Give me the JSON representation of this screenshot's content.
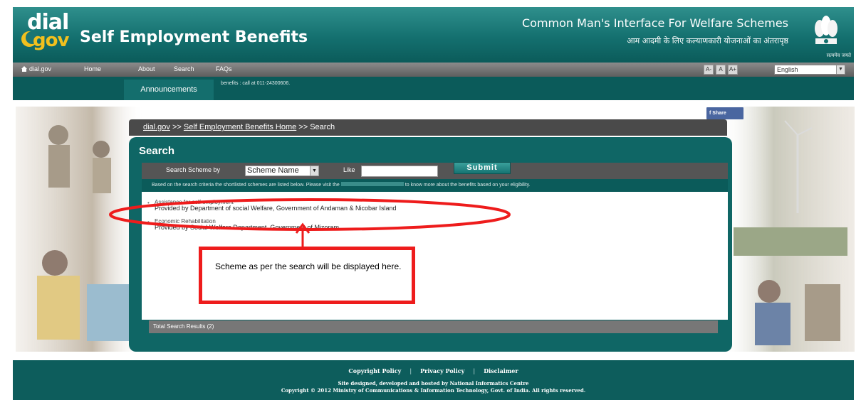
{
  "header": {
    "logo_top": "dial",
    "logo_bottom": "gov",
    "site_title": "Self Employment Benefits",
    "tagline": "Common Man's Interface For Welfare Schemes",
    "tagline_hindi": "आम आदमी के लिए कल्याणकारी योजनाओं का अंतरापृष्ठ",
    "emblem_caption": "सत्यमेव जयते"
  },
  "nav": {
    "items": [
      "dial.gov",
      "Home",
      "About",
      "Search",
      "FAQs"
    ],
    "font_buttons": [
      "A-",
      "A",
      "A+"
    ],
    "language": "English"
  },
  "announcements": {
    "tab_label": "Announcements",
    "text": "benefits : call at 011-24300606."
  },
  "share": {
    "label": "f  Share"
  },
  "breadcrumb": {
    "root": "dial.gov",
    "sep1": " >> ",
    "home": "Self Employment Benefits Home",
    "sep2": " >> ",
    "current": "Search"
  },
  "search": {
    "title": "Search",
    "scheme_by_label": "Search Scheme by",
    "scheme_by_value": "Scheme Name",
    "like_label": "Like",
    "like_value": "",
    "submit_label": "Submit",
    "info_prefix": "Based on the search criteria the shortlisted schemes are listed below. Please visit the",
    "info_suffix": "to know more about the benefits based on your eligibility."
  },
  "results": [
    {
      "name": "Assistance for self employment",
      "provider": "Provided by  Department of social Welfare, Government of Andaman & Nicobar Island"
    },
    {
      "name": "Economic Rehabilitation",
      "provider": "Provided by  Social Welfare Department, Government of Mizoram"
    }
  ],
  "total_results": "Total Search Results (2)",
  "callout": {
    "text": "Scheme as per the search will be displayed here."
  },
  "footer": {
    "links": [
      "Copyright Policy",
      "Privacy Policy",
      "Disclaimer"
    ],
    "line1": "Site designed, developed and hosted by National Informatics Centre",
    "line2": "Copyright © 2012 Ministry of Communications & Information Technology, Govt. of India. All rights reserved."
  },
  "colors": {
    "header_teal": "#14706f",
    "panel_teal": "#0f6665",
    "nav_gray": "#5e5e5e",
    "logo_yellow": "#f2c01e",
    "annotation_red": "#ee1c1c",
    "facebook_blue": "#4a66a0"
  }
}
